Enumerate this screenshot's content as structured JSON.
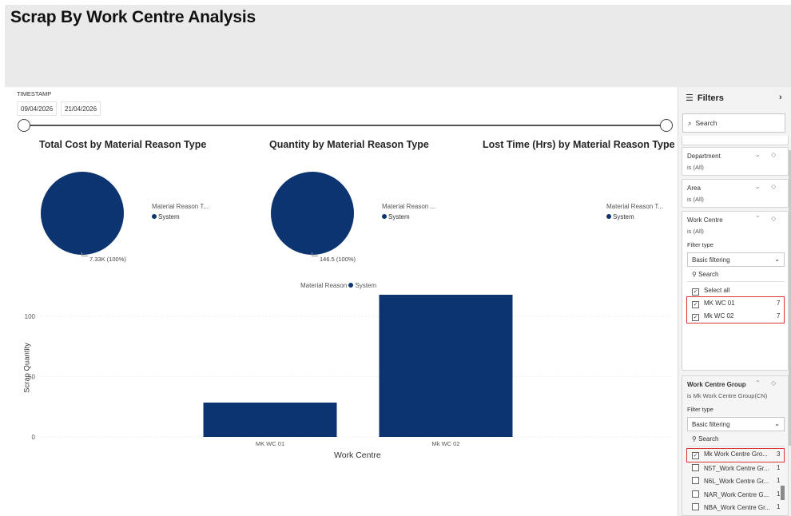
{
  "header": {
    "title": "Scrap By Work Centre Analysis"
  },
  "timestamp_slicer": {
    "label": "TIMESTAMP",
    "start": "09/04/2026",
    "end": "21/04/2026"
  },
  "pies": [
    {
      "title": "Total Cost by Material Reason Type",
      "legend_title": "Material Reason T...",
      "legend_item": "System",
      "data_label": "7.33K (100%)"
    },
    {
      "title": "Quantity by Material Reason Type",
      "legend_title": "Material Reason ...",
      "legend_item": "System",
      "data_label": "146.5 (100%)"
    },
    {
      "title": "Lost Time (Hrs) by Material Reason Type",
      "legend_title": "Material Reason T...",
      "legend_item": "System",
      "data_label": ""
    }
  ],
  "bar_chart": {
    "legend_title": "Material Reason",
    "legend_item": "System",
    "ylabel": "Scrap Quantity",
    "xlabel": "Work Centre"
  },
  "chart_data": [
    {
      "type": "pie",
      "title": "Total Cost by Material Reason Type",
      "labels": [
        "System"
      ],
      "values": [
        7330
      ],
      "colors": [
        "#0b3470"
      ]
    },
    {
      "type": "pie",
      "title": "Quantity by Material Reason Type",
      "labels": [
        "System"
      ],
      "values": [
        146.5
      ],
      "colors": [
        "#0b3470"
      ]
    },
    {
      "type": "pie",
      "title": "Lost Time (Hrs) by Material Reason Type",
      "labels": [
        "System"
      ],
      "values": []
    },
    {
      "type": "bar",
      "categories": [
        "MK WC 01",
        "Mk WC 02"
      ],
      "series": [
        {
          "name": "System",
          "values": [
            28.5,
            118
          ]
        }
      ],
      "xlabel": "Work Centre",
      "ylabel": "Scrap Quantity",
      "yticks": [
        0,
        50,
        100
      ],
      "ylim": [
        0,
        120
      ],
      "color": "#0b3470"
    }
  ],
  "filters": {
    "title": "Filters",
    "collapse_icon": "chevron-right-icon",
    "search_placeholder": "Search",
    "department": {
      "title": "Department",
      "status": "is (All)"
    },
    "area": {
      "title": "Area",
      "status": "is (All)"
    },
    "work_centre": {
      "title": "Work Centre",
      "status": "is (All)",
      "filter_type_label": "Filter type",
      "filter_type_value": "Basic filtering",
      "search": "Search",
      "select_all": "Select all",
      "items": [
        {
          "label": "MK WC 01",
          "count": "7",
          "checked": true
        },
        {
          "label": "Mk WC 02",
          "count": "7",
          "checked": true
        }
      ]
    },
    "work_centre_group": {
      "title": "Work Centre Group",
      "status": "is Mk Work Centre Group(CN)",
      "filter_type_label": "Filter type",
      "filter_type_value": "Basic filtering",
      "search": "Search",
      "items": [
        {
          "label": "Mk Work Centre Gro...",
          "count": "3",
          "checked": true
        },
        {
          "label": "N5T_Work Centre Gr...",
          "count": "1",
          "checked": false
        },
        {
          "label": "N6L_Work Centre Gr...",
          "count": "1",
          "checked": false
        },
        {
          "label": "NAR_Work Centre G...",
          "count": "1",
          "checked": false
        },
        {
          "label": "NBA_Work Centre Gr...",
          "count": "1",
          "checked": false
        }
      ]
    }
  },
  "colors": {
    "series": "#0b3470",
    "highlight": "#d9383a",
    "header_bg": "#eaeaea"
  }
}
